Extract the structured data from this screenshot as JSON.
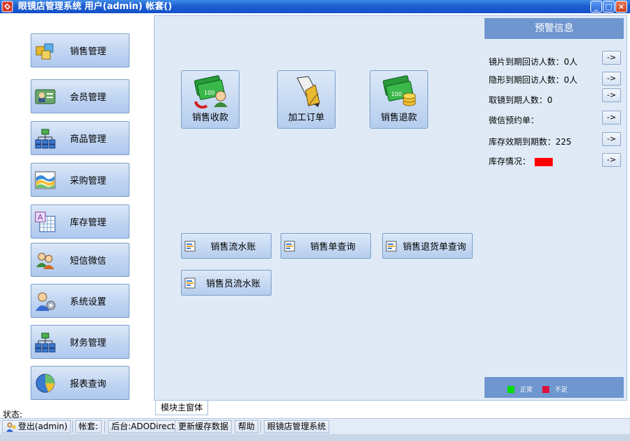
{
  "window": {
    "title": "眼镜店管理系统 用户(admin) 帐套()",
    "minimize_label": "_",
    "maximize_label": "□",
    "close_label": "×"
  },
  "sidebar": {
    "items": [
      {
        "label": "销售管理",
        "icon": "boxes-icon"
      },
      {
        "label": "会员管理",
        "icon": "member-card-icon"
      },
      {
        "label": "商品管理",
        "icon": "org-chart-icon"
      },
      {
        "label": "采购管理",
        "icon": "wave-chart-icon"
      },
      {
        "label": "库存管理",
        "icon": "calendar-grid-icon"
      },
      {
        "label": "短信微信",
        "icon": "users-icon"
      },
      {
        "label": "系统设置",
        "icon": "user-settings-icon"
      },
      {
        "label": "财务管理",
        "icon": "org-chart-icon"
      },
      {
        "label": "报表查询",
        "icon": "pie-chart-icon"
      }
    ]
  },
  "main": {
    "big_buttons": [
      {
        "label": "销售收款",
        "icon": "money-receive-icon"
      },
      {
        "label": "加工订单",
        "icon": "pen-nib-icon"
      },
      {
        "label": "销售退款",
        "icon": "money-refund-icon"
      }
    ],
    "query_buttons": [
      {
        "label": "销售流水账"
      },
      {
        "label": "销售单查询"
      },
      {
        "label": "销售退货单查询"
      },
      {
        "label": "销售员流水账"
      }
    ]
  },
  "warning": {
    "title": "预警信息",
    "rows": [
      {
        "text": "镜片到期回访人数：0人",
        "button": "->"
      },
      {
        "text": "隐形到期回访人数：0人",
        "button": "->"
      },
      {
        "text": "取镜到期人数：0",
        "button": "->"
      },
      {
        "text": "微信预约单：",
        "button": "->"
      },
      {
        "text": "库存效期到期数：225",
        "button": "->"
      },
      {
        "text": "库存情况：",
        "button": "->"
      }
    ],
    "legend": [
      {
        "label": "正常",
        "color": "#00e000"
      },
      {
        "label": "不足",
        "color": "#e0103c"
      }
    ],
    "stock_color": "#ff0000"
  },
  "tabs": {
    "active": "模块主窗体"
  },
  "status_label": "状态:",
  "statusbar": {
    "logout": "登出(admin)",
    "account": "帐套:",
    "backend": "后台:ADODirect",
    "refresh_cache": "更新缓存数据",
    "help": "帮助",
    "system": "眼镜店管理系统"
  }
}
